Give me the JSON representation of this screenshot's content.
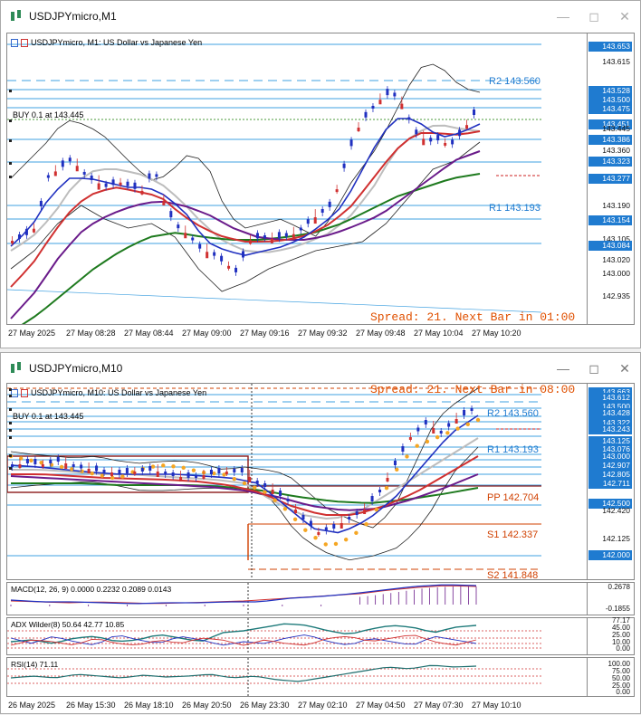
{
  "window1": {
    "title": "USDJPYmicro,M1",
    "legend": "USDJPYmicro, M1:  US Dollar vs Japanese Yen",
    "trade_label": "BUY 0.1 at 143.445",
    "spread_text": "Spread: 21. Next Bar in 01:00",
    "pivots": [
      {
        "text": "R2 143.560"
      },
      {
        "text": "R1 143.193"
      }
    ],
    "price_labels": [
      "143.653",
      "143.615",
      "143.528",
      "143.500",
      "143.475",
      "143.451",
      "143.445",
      "143.386",
      "143.360",
      "143.323",
      "143.277",
      "143.190",
      "143.154",
      "143.105",
      "143.084",
      "143.020",
      "143.000",
      "142.935"
    ],
    "time_labels": [
      "27 May 2025",
      "27 May 08:28",
      "27 May 08:44",
      "27 May 09:00",
      "27 May 09:16",
      "27 May 09:32",
      "27 May 09:48",
      "27 May 10:04",
      "27 May 10:20"
    ]
  },
  "window2": {
    "title": "USDJPYmicro,M10",
    "legend": "USDJPYmicro, M10:  US Dollar vs Japanese Yen",
    "trade_label": "BUY 0.1 at 143.445",
    "spread_text": "Spread: 21. Next Bar in 08:00",
    "pivots": [
      {
        "text": "R2 143.560"
      },
      {
        "text": "R1 143.193"
      },
      {
        "text": "PP 142.704"
      },
      {
        "text": "S1 142.337"
      },
      {
        "text": "S2 141.848"
      }
    ],
    "price_labels": [
      "143.663",
      "143.612",
      "143.500",
      "143.428",
      "143.322",
      "143.243",
      "143.125",
      "143.076",
      "143.000",
      "142.907",
      "142.805",
      "142.711",
      "142.500",
      "142.420",
      "142.125",
      "142.000"
    ],
    "macd": {
      "title": "MACD(12, 26, 9) 0.0000 0.2232 0.2089 0.0143",
      "ticks": [
        "0.2678",
        "-0.1855"
      ]
    },
    "adx": {
      "title": "ADX Wilder(8) 50.64 42.77 10.85",
      "ticks": [
        "77.17",
        "45.00",
        "25.00",
        "10.00",
        "0.00"
      ]
    },
    "rsi": {
      "title": "RSI(14) 71.11",
      "ticks": [
        "100.00",
        "75.00",
        "50.00",
        "25.00",
        "0.00"
      ]
    },
    "time_labels": [
      "26 May 2025",
      "26 May 15:30",
      "26 May 18:10",
      "26 May 20:50",
      "26 May 23:30",
      "27 May 02:10",
      "27 May 04:50",
      "27 May 07:30",
      "27 May 10:10"
    ]
  },
  "colors": {
    "blue_label": "#1f7bd0",
    "red": "#d03030",
    "orange": "#e05000",
    "green": "#1e7a1e",
    "purple": "#6a1b8a"
  }
}
